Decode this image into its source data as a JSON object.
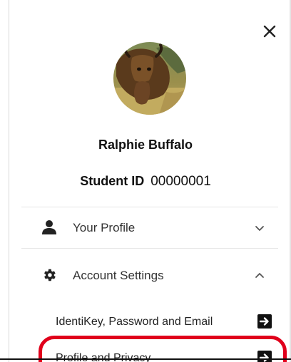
{
  "header": {
    "close_icon": "close-icon"
  },
  "profile": {
    "avatar_icon": "buffalo-avatar",
    "name": "Ralphie Buffalo",
    "student_id_label": "Student ID",
    "student_id_value": "00000001"
  },
  "menu": {
    "items": [
      {
        "label": "Your Profile",
        "icon": "person-icon",
        "expanded": false
      },
      {
        "label": "Account Settings",
        "icon": "gear-icon",
        "expanded": true
      }
    ],
    "account_settings_subitems": [
      {
        "label": "IdentiKey, Password and Email",
        "icon": "arrow-right-box-icon"
      },
      {
        "label": "Profile and Privacy",
        "icon": "arrow-right-box-icon"
      }
    ]
  },
  "colors": {
    "highlight": "#e0001b",
    "text": "#222222",
    "divider": "#e6e6e6"
  }
}
